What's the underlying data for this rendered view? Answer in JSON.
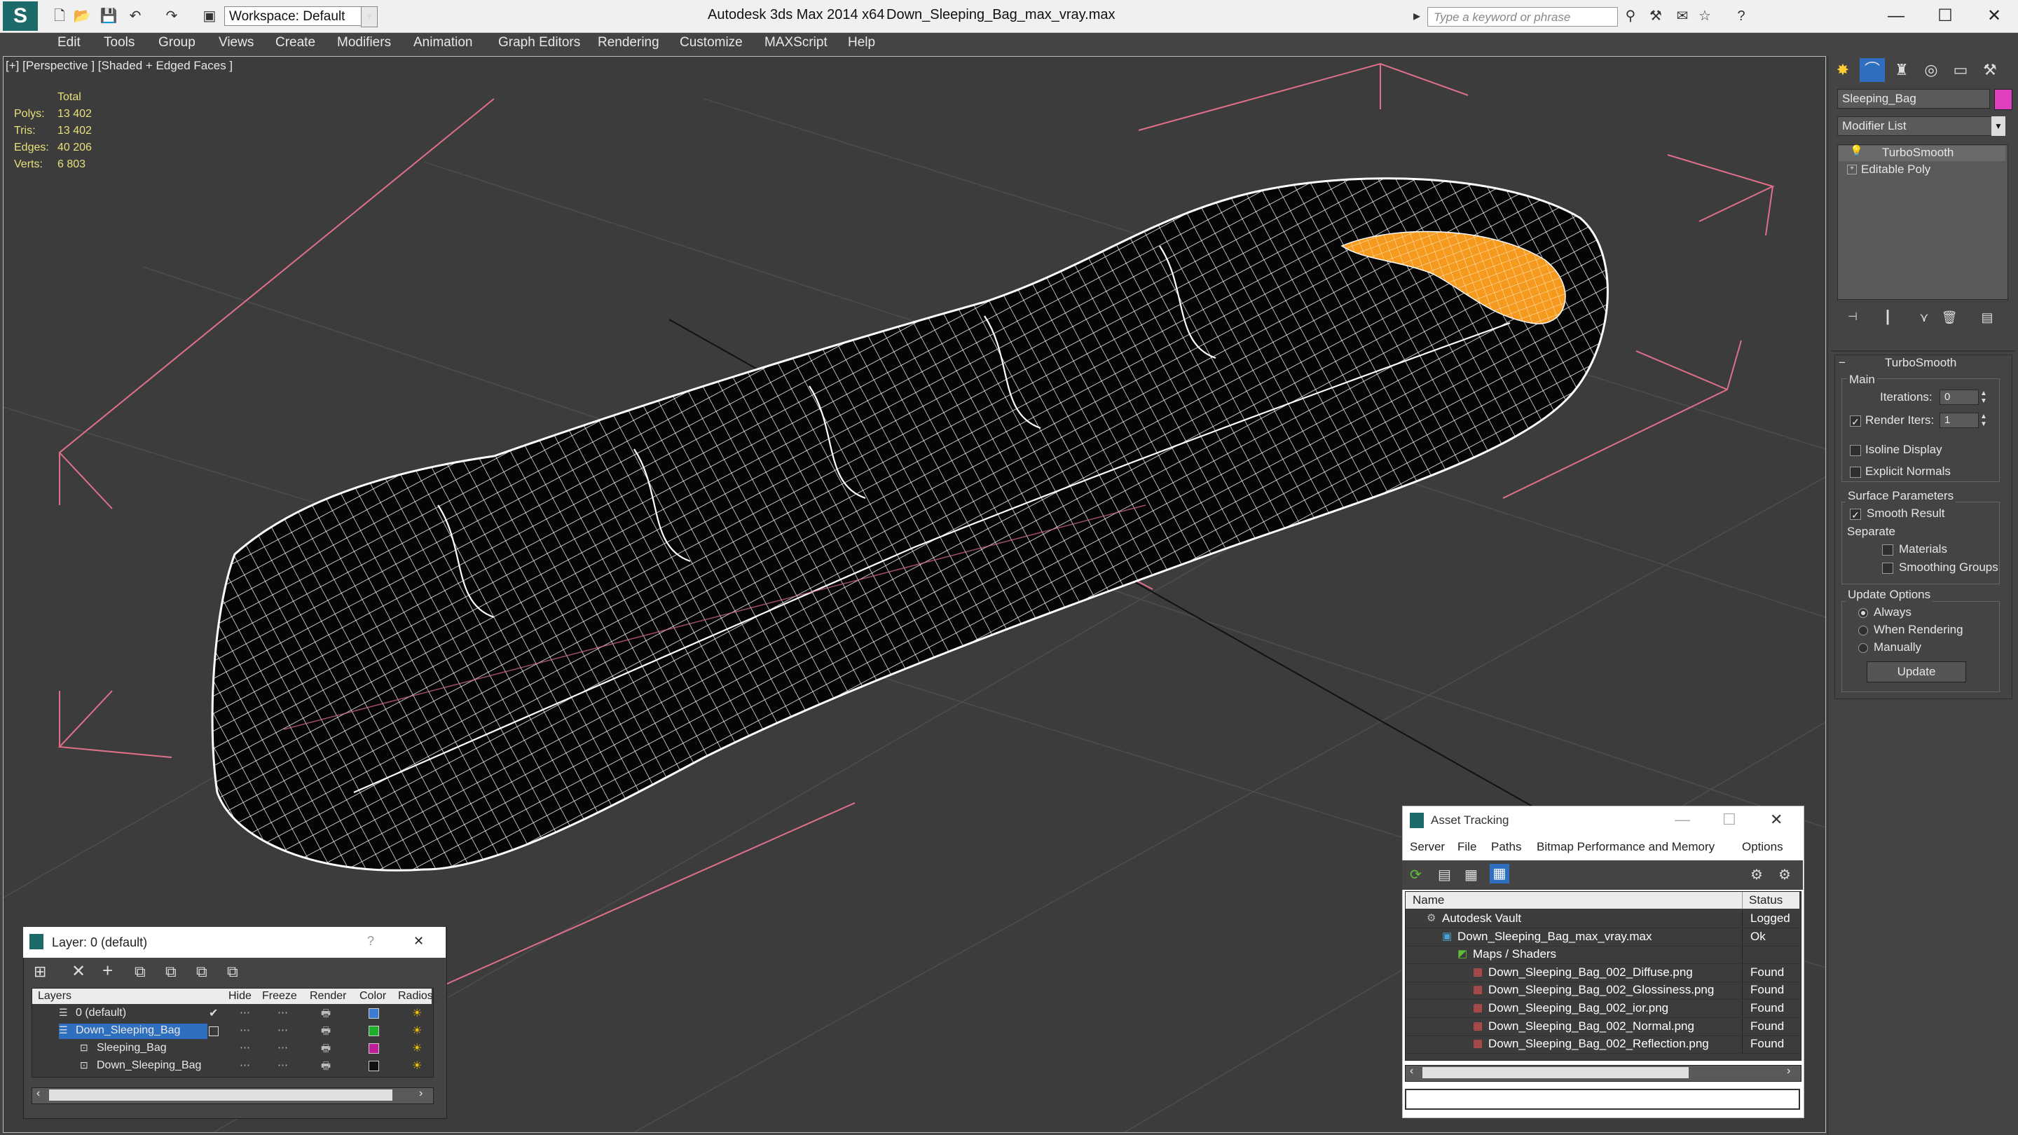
{
  "titlebar": {
    "workspace": "Workspace: Default",
    "app_title": "Autodesk 3ds Max  2014 x64",
    "file_title": "Down_Sleeping_Bag_max_vray.max",
    "search_placeholder": "Type a keyword or phrase",
    "minimize": "—",
    "maximize": "☐",
    "close": "✕"
  },
  "menu": [
    "Edit",
    "Tools",
    "Group",
    "Views",
    "Create",
    "Modifiers",
    "Animation",
    "Graph Editors",
    "Rendering",
    "Customize",
    "MAXScript",
    "Help"
  ],
  "viewport": {
    "label": "[+] [Perspective ] [Shaded + Edged Faces ]",
    "stats": {
      "header": "Total",
      "rows": [
        {
          "label": "Polys:",
          "value": "13 402"
        },
        {
          "label": "Tris:",
          "value": "13 402"
        },
        {
          "label": "Edges:",
          "value": "40 206"
        },
        {
          "label": "Verts:",
          "value": "6 803"
        }
      ]
    }
  },
  "command_panel": {
    "object_name": "Sleeping_Bag",
    "object_color": "#e040c0",
    "modifier_list": "Modifier List",
    "stack": [
      "TurboSmooth",
      "Editable Poly"
    ],
    "rollout_title": "TurboSmooth",
    "main_group": "Main",
    "iterations_label": "Iterations:",
    "iterations_value": "0",
    "render_iters_label": "Render Iters:",
    "render_iters_value": "1",
    "render_iters_checked": true,
    "isoline_display": "Isoline Display",
    "explicit_normals": "Explicit Normals",
    "surface_params": "Surface Parameters",
    "smooth_result": "Smooth Result",
    "separate": "Separate",
    "materials": "Materials",
    "smoothing_groups": "Smoothing Groups",
    "update_options": "Update Options",
    "always": "Always",
    "when_rendering": "When Rendering",
    "manually": "Manually",
    "update_button": "Update"
  },
  "layer_panel": {
    "title": "Layer: 0 (default)",
    "help": "?",
    "close": "✕",
    "columns": [
      "Layers",
      "Hide",
      "Freeze",
      "Render",
      "Color",
      "Radios"
    ],
    "rows": [
      {
        "name": "0 (default)",
        "color": "#3c7bd4",
        "selected": false,
        "indent": 1
      },
      {
        "name": "Down_Sleeping_Bag",
        "color": "#1fb02a",
        "selected": true,
        "indent": 1
      },
      {
        "name": "Sleeping_Bag",
        "color": "#c01f9a",
        "selected": false,
        "indent": 2
      },
      {
        "name": "Down_Sleeping_Bag",
        "color": "#111111",
        "selected": false,
        "indent": 2
      }
    ]
  },
  "asset_tracking": {
    "title": "Asset Tracking",
    "menu": [
      "Server",
      "File",
      "Paths",
      "Bitmap Performance and Memory",
      "Options"
    ],
    "col_name": "Name",
    "col_status": "Status",
    "rows": [
      {
        "name": "Autodesk Vault",
        "status": "Logged",
        "indent": 0
      },
      {
        "name": "Down_Sleeping_Bag_max_vray.max",
        "status": "Ok",
        "indent": 1
      },
      {
        "name": "Maps / Shaders",
        "status": "",
        "indent": 2
      },
      {
        "name": "Down_Sleeping_Bag_002_Diffuse.png",
        "status": "Found",
        "indent": 3
      },
      {
        "name": "Down_Sleeping_Bag_002_Glossiness.png",
        "status": "Found",
        "indent": 3
      },
      {
        "name": "Down_Sleeping_Bag_002_ior.png",
        "status": "Found",
        "indent": 3
      },
      {
        "name": "Down_Sleeping_Bag_002_Normal.png",
        "status": "Found",
        "indent": 3
      },
      {
        "name": "Down_Sleeping_Bag_002_Reflection.png",
        "status": "Found",
        "indent": 3
      }
    ]
  }
}
